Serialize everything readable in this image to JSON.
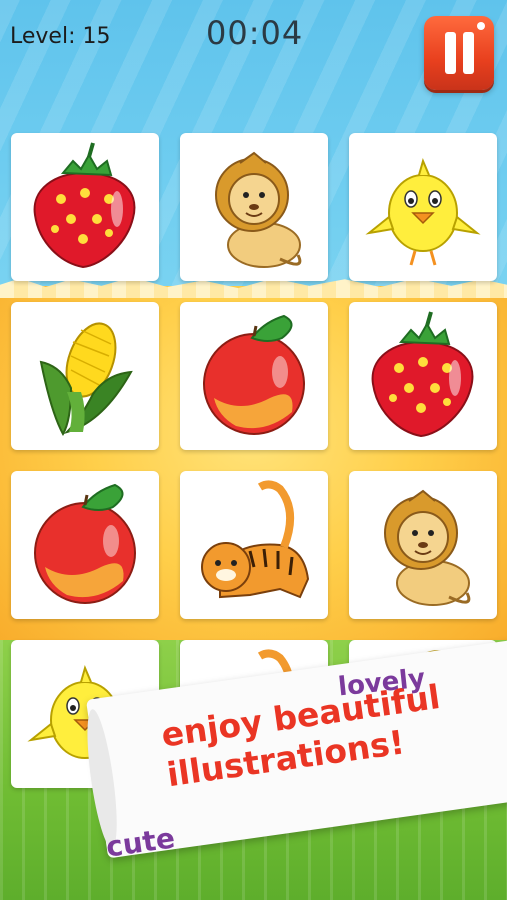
{
  "hud": {
    "level_label": "Level:",
    "level_value": "15",
    "timer": "00:04"
  },
  "pause_button": {
    "icon": "pause-icon",
    "color": "#e8401e"
  },
  "cards": [
    {
      "row": 1,
      "col": 1,
      "picture": "strawberry"
    },
    {
      "row": 1,
      "col": 2,
      "picture": "lion"
    },
    {
      "row": 1,
      "col": 3,
      "picture": "chick"
    },
    {
      "row": 2,
      "col": 1,
      "picture": "corn"
    },
    {
      "row": 2,
      "col": 2,
      "picture": "peach"
    },
    {
      "row": 2,
      "col": 3,
      "picture": "strawberry"
    },
    {
      "row": 3,
      "col": 1,
      "picture": "peach"
    },
    {
      "row": 3,
      "col": 2,
      "picture": "tiger"
    },
    {
      "row": 3,
      "col": 3,
      "picture": "lion"
    },
    {
      "row": 4,
      "col": 1,
      "picture": "chick"
    },
    {
      "row": 4,
      "col": 2,
      "picture": "tiger"
    },
    {
      "row": 4,
      "col": 3,
      "picture": "corn"
    }
  ],
  "promo": {
    "line1": "enjoy beautiful",
    "line2": "illustrations!",
    "tag_top": "lovely",
    "tag_bottom": "cute"
  },
  "colors": {
    "sky": "#6fcdf0",
    "orange": "#ffcf4a",
    "grass": "#6fbc33",
    "promo_text": "#ea3524",
    "tag_text": "#7b3a9c"
  }
}
